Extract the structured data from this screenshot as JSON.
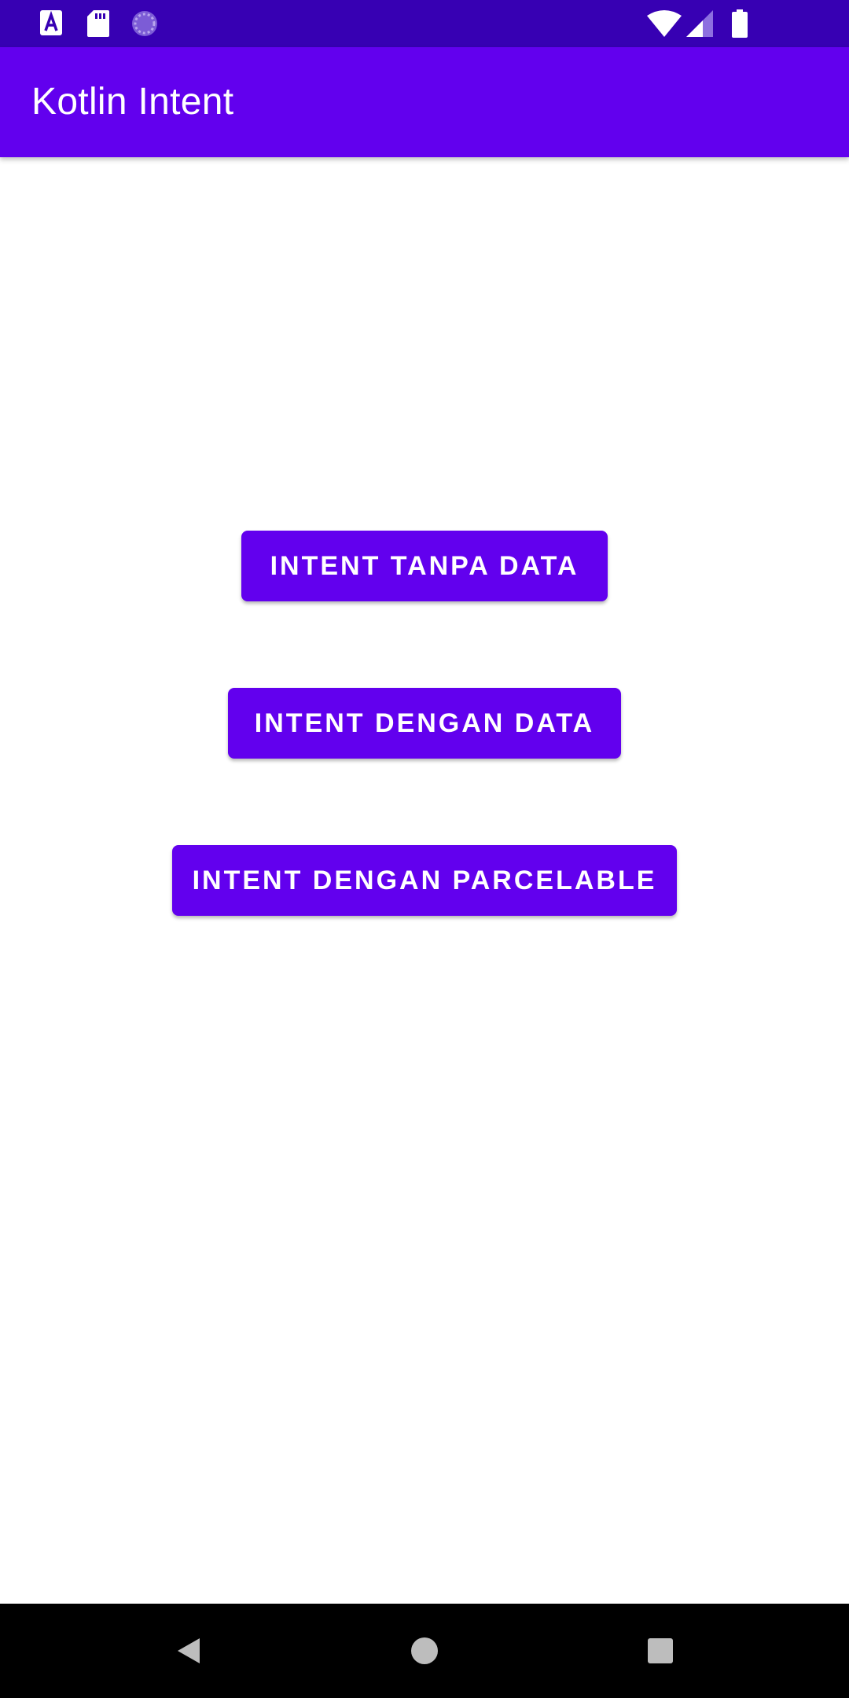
{
  "status_bar": {
    "icons": [
      "text-a-icon",
      "sd-card-icon",
      "sync-icon",
      "wifi-icon",
      "signal-icon",
      "battery-icon"
    ]
  },
  "app_bar": {
    "title": "Kotlin Intent"
  },
  "buttons": {
    "intent_tanpa_data": "INTENT TANPA DATA",
    "intent_dengan_data": "INTENT DENGAN DATA",
    "intent_dengan_parcelable": "INTENT DENGAN PARCELABLE"
  },
  "nav_bar": {
    "icons": [
      "back-icon",
      "home-icon",
      "recents-icon"
    ]
  },
  "colors": {
    "status_bar": "#3700b3",
    "primary": "#6200ee",
    "background": "#ffffff",
    "nav_bar": "#000000"
  }
}
